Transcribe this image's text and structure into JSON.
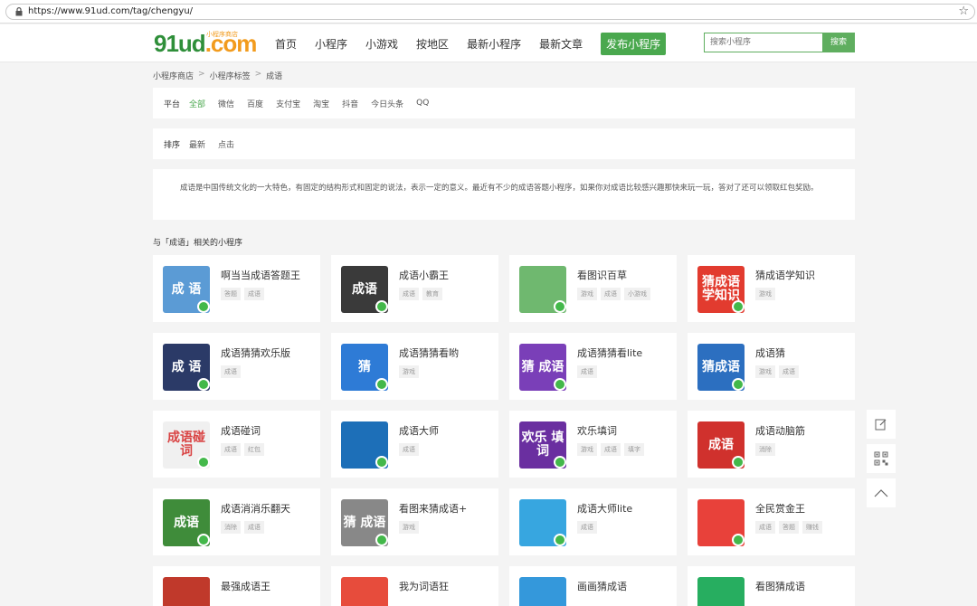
{
  "browser": {
    "url": "https://www.91ud.com/tag/chengyu/"
  },
  "header": {
    "logo_main": "91ud",
    "logo_dot": ".com",
    "logo_sub": "小程序商店",
    "nav": [
      "首页",
      "小程序",
      "小游戏",
      "按地区",
      "最新小程序",
      "最新文章"
    ],
    "publish_label": "发布小程序",
    "search_placeholder": "搜索小程序",
    "search_button": "搜索"
  },
  "breadcrumb": {
    "items": [
      "小程序商店",
      "小程序标签",
      "成语"
    ],
    "sep": ">"
  },
  "filters": {
    "platform_label": "平台",
    "platform_options": [
      "全部",
      "微信",
      "百度",
      "支付宝",
      "淘宝",
      "抖音",
      "今日头条",
      "QQ"
    ],
    "platform_active": "全部",
    "sort_label": "排序",
    "sort_options": [
      "最新",
      "点击"
    ]
  },
  "description": "成语是中国传统文化的一大特色，有固定的结构形式和固定的说法，表示一定的意义。最近有不少的成语答题小程序，如果你对成语比较感兴趣那快来玩一玩，答对了还可以领取红包奖励。",
  "section_title": "与「成语」相关的小程序",
  "apps": [
    {
      "title": "啊当当成语答题王",
      "tags": [
        "答题",
        "成语"
      ],
      "color": "#5b9bd5",
      "glyph": "成 语"
    },
    {
      "title": "成语小霸王",
      "tags": [
        "成语",
        "教育"
      ],
      "color": "#3a3a3a",
      "glyph": "成语"
    },
    {
      "title": "看图识百草",
      "tags": [
        "游戏",
        "成语",
        "小游戏"
      ],
      "color": "#6fb86f",
      "glyph": ""
    },
    {
      "title": "猜成语学知识",
      "tags": [
        "游戏"
      ],
      "color": "#e23b2f",
      "glyph": "猜成语 学知识"
    },
    {
      "title": "成语猜猜欢乐版",
      "tags": [
        "成语"
      ],
      "color": "#2b3a67",
      "glyph": "成 语"
    },
    {
      "title": "成语猜猜看哟",
      "tags": [
        "游戏"
      ],
      "color": "#2e7bd6",
      "glyph": "猜"
    },
    {
      "title": "成语猜猜看lite",
      "tags": [
        "成语"
      ],
      "color": "#7a3fb8",
      "glyph": "猜 成语"
    },
    {
      "title": "成语猜",
      "tags": [
        "游戏",
        "成语"
      ],
      "color": "#2c6fc0",
      "glyph": "猜成语"
    },
    {
      "title": "成语碰词",
      "tags": [
        "成语",
        "红包"
      ],
      "color": "#f0f0f0",
      "glyph": "成语碰词"
    },
    {
      "title": "成语大师",
      "tags": [
        "成语"
      ],
      "color": "#1d6fb8",
      "glyph": ""
    },
    {
      "title": "欢乐填词",
      "tags": [
        "游戏",
        "成语",
        "填字"
      ],
      "color": "#6a2fa0",
      "glyph": "欢乐 填词"
    },
    {
      "title": "成语动脑筋",
      "tags": [
        "消除"
      ],
      "color": "#d0312d",
      "glyph": "成语"
    },
    {
      "title": "成语消消乐翻天",
      "tags": [
        "消除",
        "成语"
      ],
      "color": "#3f8c3a",
      "glyph": "成语"
    },
    {
      "title": "看图来猜成语+",
      "tags": [
        "游戏"
      ],
      "color": "#888888",
      "glyph": "猜 成语"
    },
    {
      "title": "成语大师lite",
      "tags": [
        "成语"
      ],
      "color": "#37a6e0",
      "glyph": ""
    },
    {
      "title": "全民赏金王",
      "tags": [
        "成语",
        "答题",
        "赚钱"
      ],
      "color": "#e8413a",
      "glyph": ""
    },
    {
      "title": "最强成语王",
      "tags": [],
      "color": "#c0392b",
      "glyph": ""
    },
    {
      "title": "我为词语狂",
      "tags": [],
      "color": "#e74c3c",
      "glyph": ""
    },
    {
      "title": "画画猜成语",
      "tags": [],
      "color": "#3498db",
      "glyph": ""
    },
    {
      "title": "看图猜成语",
      "tags": [],
      "color": "#27ae60",
      "glyph": ""
    }
  ],
  "side_tools": [
    "edit-icon",
    "qrcode-icon",
    "back-to-top-icon"
  ]
}
